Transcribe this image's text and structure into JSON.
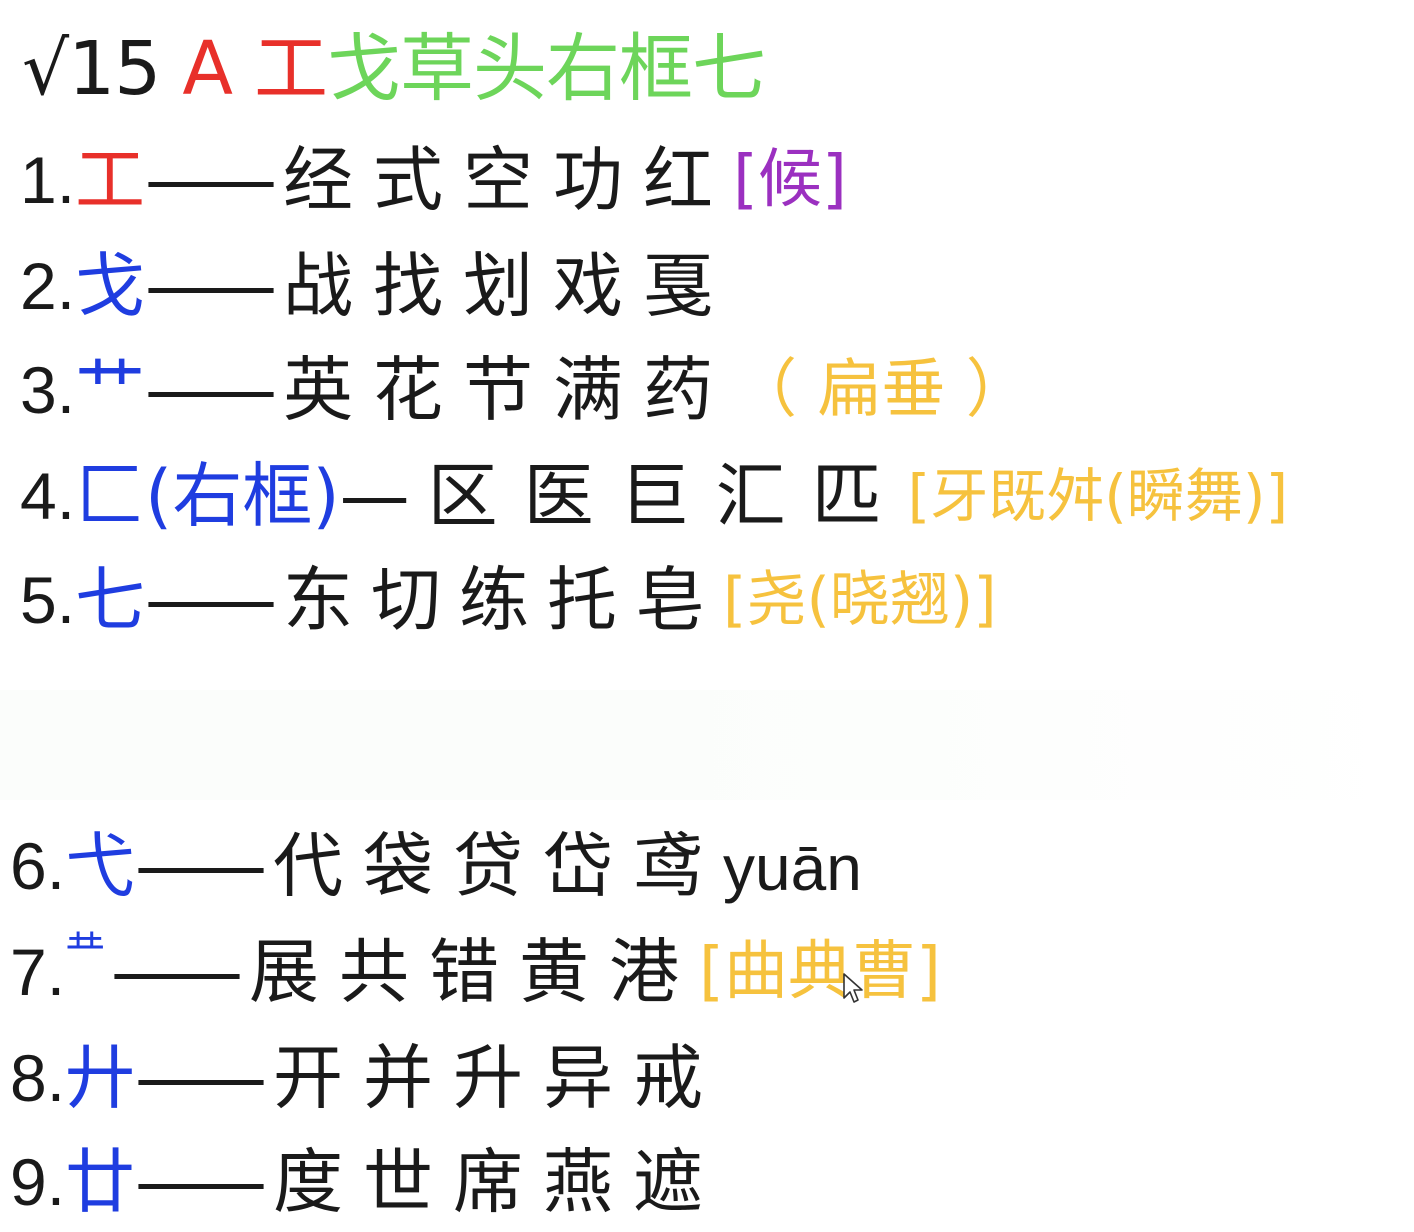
{
  "title": {
    "check": "√15",
    "letter": "A",
    "radical": "工",
    "rest": "戈草头右框七"
  },
  "colors": {
    "black": "#1a1a1a",
    "red": "#e8302a",
    "blue": "#1f3de0",
    "green": "#6dd55a",
    "purple": "#9b30c0",
    "orange": "#f6c23e"
  },
  "rows": [
    {
      "num": "1.",
      "radical": "工",
      "dash": "——",
      "chars": "经式空功红",
      "note": "[候]"
    },
    {
      "num": "2.",
      "radical": "戈",
      "dash": "——",
      "chars": "战找划戏戛",
      "note": ""
    },
    {
      "num": "3.",
      "radical": "艹",
      "dash": "——",
      "chars": "英花节满药",
      "note": "（ 扁垂 ）"
    },
    {
      "num": "4.",
      "radical": "匚(右框)",
      "dash": "—",
      "chars": "区医巨汇匹",
      "note": "[牙既舛(瞬舞)]"
    },
    {
      "num": "5.",
      "radical": "七",
      "dash": "——",
      "chars": "东切练托皂",
      "note": "[尧(晓翘)]"
    },
    {
      "num": "6.",
      "radical": "弋",
      "dash": "——",
      "chars": "代袋贷岱鸢",
      "pinyin": "yuān"
    },
    {
      "num": "7.",
      "radical": "龷",
      "dash": "——",
      "chars": "展共错黄港",
      "note": "[曲典曹]"
    },
    {
      "num": "8.",
      "radical": "廾",
      "dash": "——",
      "chars": "开并升异戒",
      "note": ""
    },
    {
      "num": "9.",
      "radical": "廿",
      "dash": "——",
      "chars": "度世席燕遮",
      "note": ""
    }
  ]
}
